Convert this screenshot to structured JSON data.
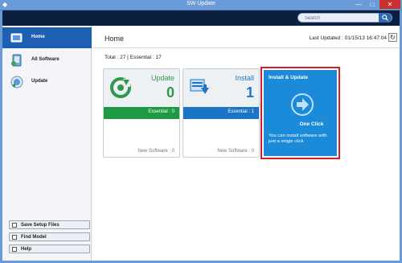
{
  "window": {
    "title": "SW Update",
    "minimize": "—",
    "maximize": "□",
    "close": "✕"
  },
  "search": {
    "placeholder": "Search",
    "icon": "search-icon"
  },
  "sidebar": {
    "items": [
      {
        "label": "Home",
        "icon": "home-icon",
        "active": true
      },
      {
        "label": "All Software",
        "icon": "software-icon",
        "active": false
      },
      {
        "label": "Update",
        "icon": "update-globe-icon",
        "active": false
      }
    ],
    "buttons": [
      {
        "label": "Save Setup Files",
        "icon": "save-icon"
      },
      {
        "label": "Find Model",
        "icon": "find-icon"
      },
      {
        "label": "Help",
        "icon": "help-icon"
      }
    ]
  },
  "main": {
    "title": "Home",
    "last_updated": "Last Updated : 01/15/13 16:47:04",
    "refresh_icon": "refresh-icon",
    "refresh_glyph": "↻",
    "totals": "Total : 27 | Essential : 17",
    "cards": [
      {
        "label": "Update",
        "count": "0",
        "essential": "Essential : 0",
        "new_software": "New Software : 0",
        "color": "#1e9a44",
        "icon": "update-refresh-icon"
      },
      {
        "label": "Install",
        "count": "1",
        "essential": "Essential : 1",
        "new_software": "New Software : 0",
        "color": "#1b74c6",
        "icon": "install-download-icon"
      }
    ],
    "one_click": {
      "title": "Install & Update",
      "label": "One Click",
      "description": "You can install software with just a single click",
      "color": "#1b8ad9",
      "highlight": "#d11e2a",
      "icon": "arrow-right-circle-icon"
    }
  }
}
